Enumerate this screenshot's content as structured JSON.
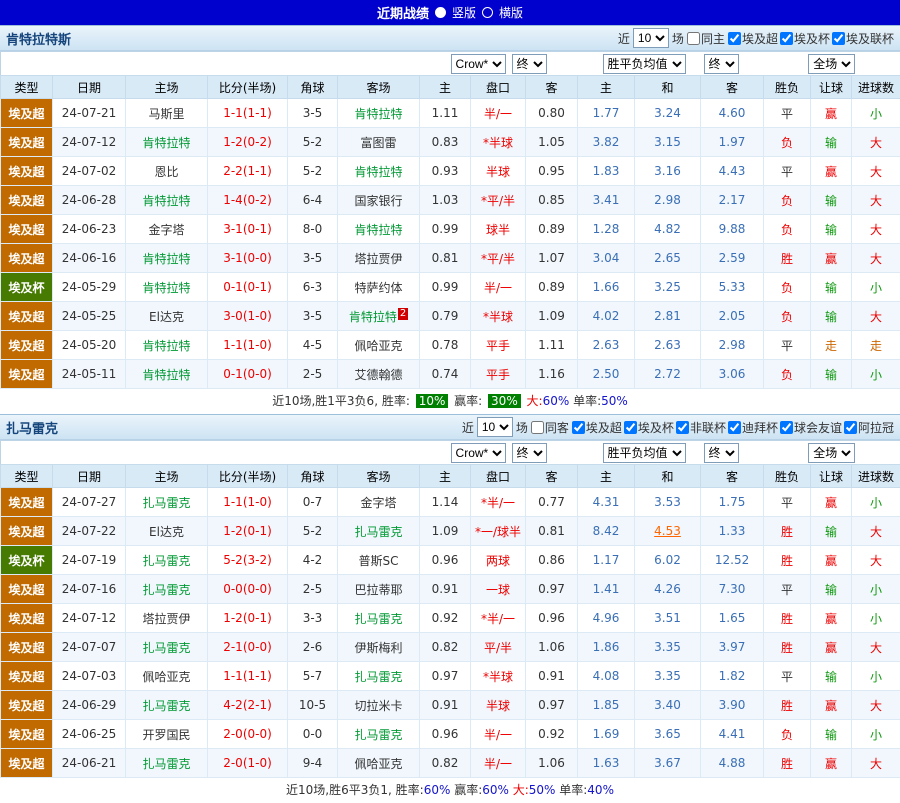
{
  "colors": {
    "topbar_bg": "#0101CE",
    "league_super_bg": "#C06A00",
    "league_cup_bg": "#467A00",
    "focus_team": "#009933",
    "score_text": "#EE0000",
    "handicap_text": "#EE0000",
    "avg_text": "#3A6FB5",
    "avg_changed_text": "#FF6600",
    "win_text": "#EE0000",
    "lose_handicap_text": "#119911",
    "push_text": "#CC6600",
    "summary_highlight_bg": "#008000",
    "percent_text": "#1414CC"
  },
  "top_bar": {
    "title": "近期战绩",
    "vertical": "竖版",
    "horizontal": "横版"
  },
  "filter_labels": {
    "near": "近",
    "count": "10",
    "games": "场"
  },
  "selects": {
    "company": "Crow*",
    "company_time": "终",
    "avg": "胜平负均值",
    "avg_time": "终",
    "scope": "全场"
  },
  "table_labels": {
    "type": "类型",
    "date": "日期",
    "home": "主场",
    "score": "比分(半场)",
    "corner": "角球",
    "away": "客场",
    "odds_home": "主",
    "handicap": "盘口",
    "odds_away": "客",
    "avg_home": "主",
    "avg_draw": "和",
    "avg_away": "客",
    "result": "胜负",
    "handicap_result": "让球",
    "goals": "进球数"
  },
  "sections": [
    {
      "team": "肯特拉特斯",
      "same_label": "同主",
      "leagues": [
        "埃及超",
        "埃及杯",
        "埃及联杯"
      ],
      "rows": [
        {
          "league": "埃及超",
          "date": "24-07-21",
          "home": "马斯里",
          "home_focus": false,
          "score": "1-1(1-1)",
          "corners": "3-5",
          "away": "肯特拉特",
          "away_focus": true,
          "odds_home": "1.11",
          "handicap": "半/一",
          "odds_away": "0.80",
          "avg_home": "1.77",
          "avg_draw": "3.24",
          "avg_away": "4.60",
          "result": "平",
          "handicap_result": "赢",
          "goals": "小"
        },
        {
          "league": "埃及超",
          "date": "24-07-12",
          "home": "肯特拉特",
          "home_focus": true,
          "score": "1-2(0-2)",
          "corners": "5-2",
          "away": "富图雷",
          "away_focus": false,
          "odds_home": "0.83",
          "handicap": "*半球",
          "odds_away": "1.05",
          "avg_home": "3.82",
          "avg_draw": "3.15",
          "avg_away": "1.97",
          "result": "负",
          "handicap_result": "输",
          "goals": "大"
        },
        {
          "league": "埃及超",
          "date": "24-07-02",
          "home": "恩比",
          "home_focus": false,
          "score": "2-2(1-1)",
          "corners": "5-2",
          "away": "肯特拉特",
          "away_focus": true,
          "odds_home": "0.93",
          "handicap": "半球",
          "odds_away": "0.95",
          "avg_home": "1.83",
          "avg_draw": "3.16",
          "avg_away": "4.43",
          "result": "平",
          "handicap_result": "赢",
          "goals": "大"
        },
        {
          "league": "埃及超",
          "date": "24-06-28",
          "home": "肯特拉特",
          "home_focus": true,
          "score": "1-4(0-2)",
          "corners": "6-4",
          "away": "国家银行",
          "away_focus": false,
          "odds_home": "1.03",
          "handicap": "*平/半",
          "odds_away": "0.85",
          "avg_home": "3.41",
          "avg_draw": "2.98",
          "avg_away": "2.17",
          "result": "负",
          "handicap_result": "输",
          "goals": "大"
        },
        {
          "league": "埃及超",
          "date": "24-06-23",
          "home": "金字塔",
          "home_focus": false,
          "score": "3-1(0-1)",
          "corners": "8-0",
          "away": "肯特拉特",
          "away_focus": true,
          "odds_home": "0.99",
          "handicap": "球半",
          "odds_away": "0.89",
          "avg_home": "1.28",
          "avg_draw": "4.82",
          "avg_away": "9.88",
          "result": "负",
          "handicap_result": "输",
          "goals": "大"
        },
        {
          "league": "埃及超",
          "date": "24-06-16",
          "home": "肯特拉特",
          "home_focus": true,
          "score": "3-1(0-0)",
          "corners": "3-5",
          "away": "塔拉贾伊",
          "away_focus": false,
          "odds_home": "0.81",
          "handicap": "*平/半",
          "odds_away": "1.07",
          "avg_home": "3.04",
          "avg_draw": "2.65",
          "avg_away": "2.59",
          "result": "胜",
          "handicap_result": "赢",
          "goals": "大"
        },
        {
          "league": "埃及杯",
          "date": "24-05-29",
          "home": "肯特拉特",
          "home_focus": true,
          "score": "0-1(0-1)",
          "corners": "6-3",
          "away": "特萨约体",
          "away_focus": false,
          "odds_home": "0.99",
          "handicap": "半/一",
          "odds_away": "0.89",
          "avg_home": "1.66",
          "avg_draw": "3.25",
          "avg_away": "5.33",
          "result": "负",
          "handicap_result": "输",
          "goals": "小"
        },
        {
          "league": "埃及超",
          "date": "24-05-25",
          "home": "El达克",
          "home_focus": false,
          "score": "3-0(1-0)",
          "corners": "3-5",
          "away": "肯特拉特",
          "away_focus": true,
          "away_badge": "2",
          "odds_home": "0.79",
          "handicap": "*半球",
          "odds_away": "1.09",
          "avg_home": "4.02",
          "avg_draw": "2.81",
          "avg_away": "2.05",
          "result": "负",
          "handicap_result": "输",
          "goals": "大"
        },
        {
          "league": "埃及超",
          "date": "24-05-20",
          "home": "肯特拉特",
          "home_focus": true,
          "score": "1-1(1-0)",
          "corners": "4-5",
          "away": "佩哈亚克",
          "away_focus": false,
          "odds_home": "0.78",
          "handicap": "平手",
          "odds_away": "1.11",
          "avg_home": "2.63",
          "avg_draw": "2.63",
          "avg_away": "2.98",
          "result": "平",
          "handicap_result": "走",
          "goals": "走"
        },
        {
          "league": "埃及超",
          "date": "24-05-11",
          "home": "肯特拉特",
          "home_focus": true,
          "score": "0-1(0-0)",
          "corners": "2-5",
          "away": "艾德翰德",
          "away_focus": false,
          "odds_home": "0.74",
          "handicap": "平手",
          "odds_away": "1.16",
          "avg_home": "2.50",
          "avg_draw": "2.72",
          "avg_away": "3.06",
          "result": "负",
          "handicap_result": "输",
          "goals": "小"
        }
      ],
      "summary": [
        {
          "t": "近10场,胜1平3负6, 胜率: ",
          "s": "plain"
        },
        {
          "t": "10%",
          "s": "highlight"
        },
        {
          "t": " 赢率: ",
          "s": "plain"
        },
        {
          "t": "30%",
          "s": "highlight"
        },
        {
          "t": " 大:",
          "s": "red"
        },
        {
          "t": "60%",
          "s": "blue"
        },
        {
          "t": " 单率:",
          "s": "plain"
        },
        {
          "t": "50%",
          "s": "blue"
        }
      ]
    },
    {
      "team": "扎马雷克",
      "same_label": "同客",
      "leagues": [
        "埃及超",
        "埃及杯",
        "非联杯",
        "迪拜杯",
        "球会友谊",
        "阿拉冠"
      ],
      "rows": [
        {
          "league": "埃及超",
          "date": "24-07-27",
          "home": "扎马雷克",
          "home_focus": true,
          "score": "1-1(1-0)",
          "corners": "0-7",
          "away": "金字塔",
          "away_focus": false,
          "odds_home": "1.14",
          "handicap": "*半/一",
          "odds_away": "0.77",
          "avg_home": "4.31",
          "avg_draw": "3.53",
          "avg_away": "1.75",
          "result": "平",
          "handicap_result": "赢",
          "goals": "小"
        },
        {
          "league": "埃及超",
          "date": "24-07-22",
          "home": "El达克",
          "home_focus": false,
          "score": "1-2(0-1)",
          "corners": "5-2",
          "away": "扎马雷克",
          "away_focus": true,
          "odds_home": "1.09",
          "handicap": "*一/球半",
          "odds_away": "0.81",
          "avg_home": "8.42",
          "avg_draw": "4.53",
          "avg_draw_changed": true,
          "avg_away": "1.33",
          "result": "胜",
          "handicap_result": "输",
          "goals": "大"
        },
        {
          "league": "埃及杯",
          "date": "24-07-19",
          "home": "扎马雷克",
          "home_focus": true,
          "score": "5-2(3-2)",
          "corners": "4-2",
          "away": "普斯SC",
          "away_focus": false,
          "odds_home": "0.96",
          "handicap": "两球",
          "odds_away": "0.86",
          "avg_home": "1.17",
          "avg_draw": "6.02",
          "avg_away": "12.52",
          "result": "胜",
          "handicap_result": "赢",
          "goals": "大"
        },
        {
          "league": "埃及超",
          "date": "24-07-16",
          "home": "扎马雷克",
          "home_focus": true,
          "score": "0-0(0-0)",
          "corners": "2-5",
          "away": "巴拉蒂耶",
          "away_focus": false,
          "odds_home": "0.91",
          "handicap": "一球",
          "odds_away": "0.97",
          "avg_home": "1.41",
          "avg_draw": "4.26",
          "avg_away": "7.30",
          "result": "平",
          "handicap_result": "输",
          "goals": "小"
        },
        {
          "league": "埃及超",
          "date": "24-07-12",
          "home": "塔拉贾伊",
          "home_focus": false,
          "score": "1-2(0-1)",
          "corners": "3-3",
          "away": "扎马雷克",
          "away_focus": true,
          "odds_home": "0.92",
          "handicap": "*半/一",
          "odds_away": "0.96",
          "avg_home": "4.96",
          "avg_draw": "3.51",
          "avg_away": "1.65",
          "result": "胜",
          "handicap_result": "赢",
          "goals": "小"
        },
        {
          "league": "埃及超",
          "date": "24-07-07",
          "home": "扎马雷克",
          "home_focus": true,
          "score": "2-1(0-0)",
          "corners": "2-6",
          "away": "伊斯梅利",
          "away_focus": false,
          "odds_home": "0.82",
          "handicap": "平/半",
          "odds_away": "1.06",
          "avg_home": "1.86",
          "avg_draw": "3.35",
          "avg_away": "3.97",
          "result": "胜",
          "handicap_result": "赢",
          "goals": "大"
        },
        {
          "league": "埃及超",
          "date": "24-07-03",
          "home": "佩哈亚克",
          "home_focus": false,
          "score": "1-1(1-1)",
          "corners": "5-7",
          "away": "扎马雷克",
          "away_focus": true,
          "odds_home": "0.97",
          "handicap": "*半球",
          "odds_away": "0.91",
          "avg_home": "4.08",
          "avg_draw": "3.35",
          "avg_away": "1.82",
          "result": "平",
          "handicap_result": "输",
          "goals": "小"
        },
        {
          "league": "埃及超",
          "date": "24-06-29",
          "home": "扎马雷克",
          "home_focus": true,
          "score": "4-2(2-1)",
          "corners": "10-5",
          "away": "切拉米卡",
          "away_focus": false,
          "odds_home": "0.91",
          "handicap": "半球",
          "odds_away": "0.97",
          "avg_home": "1.85",
          "avg_draw": "3.40",
          "avg_away": "3.90",
          "result": "胜",
          "handicap_result": "赢",
          "goals": "大"
        },
        {
          "league": "埃及超",
          "date": "24-06-25",
          "home": "开罗国民",
          "home_focus": false,
          "score": "2-0(0-0)",
          "corners": "0-0",
          "away": "扎马雷克",
          "away_focus": true,
          "odds_home": "0.96",
          "handicap": "半/一",
          "odds_away": "0.92",
          "avg_home": "1.69",
          "avg_draw": "3.65",
          "avg_away": "4.41",
          "result": "负",
          "handicap_result": "输",
          "goals": "小"
        },
        {
          "league": "埃及超",
          "date": "24-06-21",
          "home": "扎马雷克",
          "home_focus": true,
          "score": "2-0(1-0)",
          "corners": "9-4",
          "away": "佩哈亚克",
          "away_focus": false,
          "odds_home": "0.82",
          "handicap": "半/一",
          "odds_away": "1.06",
          "avg_home": "1.63",
          "avg_draw": "3.67",
          "avg_away": "4.88",
          "result": "胜",
          "handicap_result": "赢",
          "goals": "大"
        }
      ],
      "summary": [
        {
          "t": "近10场,胜6平3负1, 胜率:",
          "s": "plain"
        },
        {
          "t": "60%",
          "s": "blue"
        },
        {
          "t": " 赢率:",
          "s": "plain"
        },
        {
          "t": "60%",
          "s": "blue"
        },
        {
          "t": " 大:",
          "s": "red"
        },
        {
          "t": "50%",
          "s": "blue"
        },
        {
          "t": " 单率:",
          "s": "plain"
        },
        {
          "t": "40%",
          "s": "blue"
        }
      ]
    }
  ]
}
